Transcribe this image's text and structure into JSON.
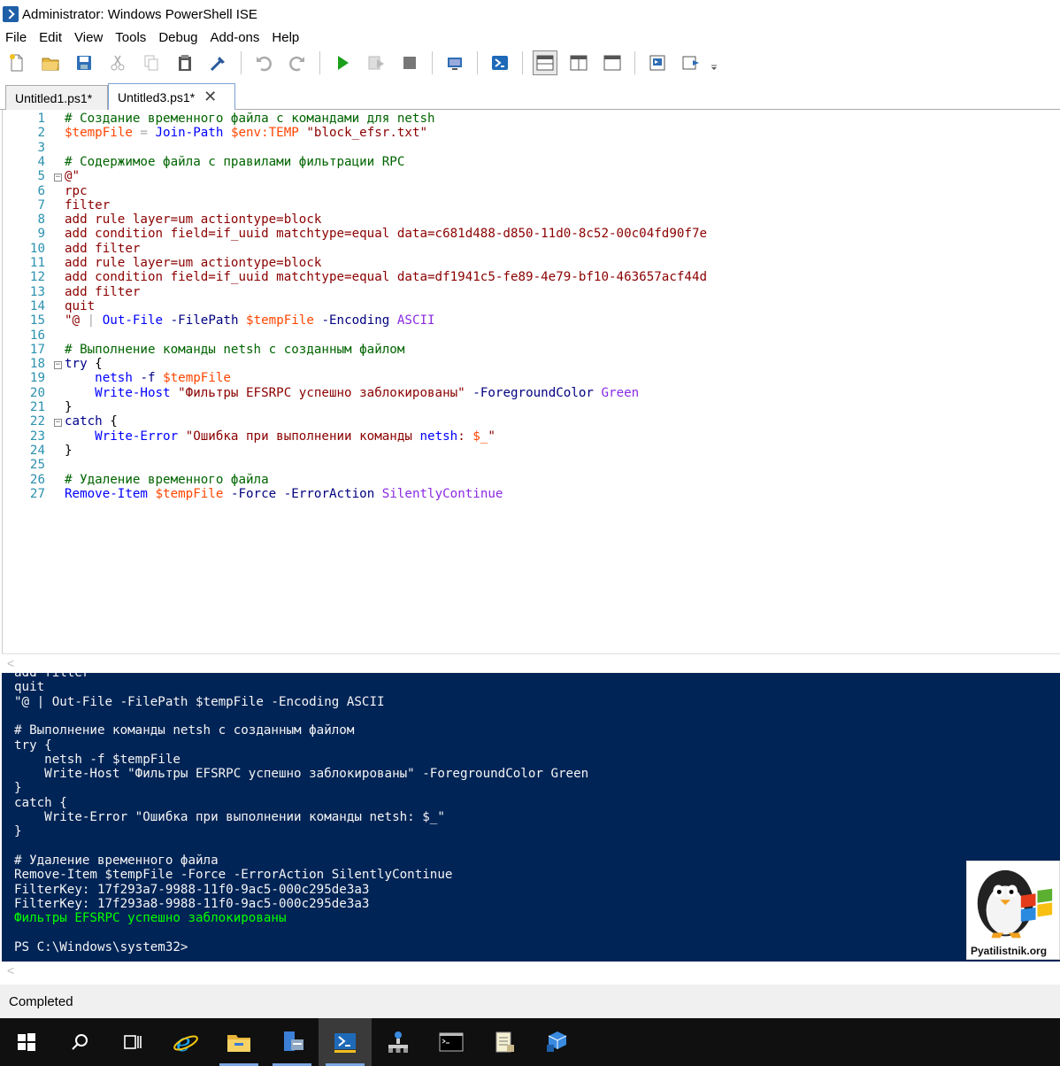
{
  "window": {
    "title": "Administrator: Windows PowerShell ISE"
  },
  "menu": [
    "File",
    "Edit",
    "View",
    "Tools",
    "Debug",
    "Add-ons",
    "Help"
  ],
  "toolbar_icons": [
    "new-file-icon",
    "open-folder-icon",
    "save-icon",
    "cut-icon",
    "copy-icon",
    "paste-icon",
    "clear-console-icon",
    "undo-icon",
    "redo-icon",
    "run-script-icon",
    "run-selection-icon",
    "stop-icon",
    "remote-powershell-icon",
    "powershell-icon",
    "layout-top-icon",
    "layout-right-icon",
    "layout-max-icon",
    "show-command-icon",
    "show-addon-icon",
    "toolbar-overflow-icon"
  ],
  "tabs": [
    {
      "label": "Untitled1.ps1*",
      "active": false
    },
    {
      "label": "Untitled3.ps1*",
      "active": true,
      "close": "✕"
    }
  ],
  "editor": {
    "lines": [
      {
        "n": "1",
        "text": "# Создание временного файла с командами для netsh"
      },
      {
        "n": "2",
        "text": "$tempFile = Join-Path $env:TEMP \"block_efsr.txt\""
      },
      {
        "n": "3",
        "text": ""
      },
      {
        "n": "4",
        "text": "# Содержимое файла с правилами фильтрации RPC"
      },
      {
        "n": "5",
        "text": "@\""
      },
      {
        "n": "6",
        "text": "rpc"
      },
      {
        "n": "7",
        "text": "filter"
      },
      {
        "n": "8",
        "text": "add rule layer=um actiontype=block"
      },
      {
        "n": "9",
        "text": "add condition field=if_uuid matchtype=equal data=c681d488-d850-11d0-8c52-00c04fd90f7e"
      },
      {
        "n": "10",
        "text": "add filter"
      },
      {
        "n": "11",
        "text": "add rule layer=um actiontype=block"
      },
      {
        "n": "12",
        "text": "add condition field=if_uuid matchtype=equal data=df1941c5-fe89-4e79-bf10-463657acf44d"
      },
      {
        "n": "13",
        "text": "add filter"
      },
      {
        "n": "14",
        "text": "quit"
      },
      {
        "n": "15",
        "text": "\"@ | Out-File -FilePath $tempFile -Encoding ASCII"
      },
      {
        "n": "16",
        "text": ""
      },
      {
        "n": "17",
        "text": "# Выполнение команды netsh с созданным файлом"
      },
      {
        "n": "18",
        "text": "try {"
      },
      {
        "n": "19",
        "text": "    netsh -f $tempFile"
      },
      {
        "n": "20",
        "text": "    Write-Host \"Фильтры EFSRPC успешно заблокированы\" -ForegroundColor Green"
      },
      {
        "n": "21",
        "text": "}"
      },
      {
        "n": "22",
        "text": "catch {"
      },
      {
        "n": "23",
        "text": "    Write-Error \"Ошибка при выполнении команды netsh: $_\""
      },
      {
        "n": "24",
        "text": "}"
      },
      {
        "n": "25",
        "text": ""
      },
      {
        "n": "26",
        "text": "# Удаление временного файла"
      },
      {
        "n": "27",
        "text": "Remove-Item $tempFile -Force -ErrorAction SilentlyContinue"
      }
    ]
  },
  "console": {
    "lines": [
      "add filter",
      "quit",
      "\"@ | Out-File -FilePath $tempFile -Encoding ASCII",
      "",
      "# Выполнение команды netsh с созданным файлом",
      "try {",
      "    netsh -f $tempFile",
      "    Write-Host \"Фильтры EFSRPC успешно заблокированы\" -ForegroundColor Green",
      "}",
      "catch {",
      "    Write-Error \"Ошибка при выполнении команды netsh: $_\"",
      "}",
      "",
      "# Удаление временного файла",
      "Remove-Item $tempFile -Force -ErrorAction SilentlyContinue",
      "FilterKey: 17f293a7-9988-11f0-9ac5-000c295de3a3",
      "FilterKey: 17f293a8-9988-11f0-9ac5-000c295de3a3",
      "Фильтры EFSRPC успешно заблокированы",
      "",
      "PS C:\\Windows\\system32>"
    ],
    "green_line_index": 17,
    "background": "#012456",
    "success_color": "#00ff00"
  },
  "status": {
    "text": "Completed"
  },
  "watermark": {
    "text": "Pyatilistnik.org"
  },
  "taskbar": {
    "items": [
      {
        "name": "start-icon"
      },
      {
        "name": "search-icon"
      },
      {
        "name": "task-view-icon"
      },
      {
        "name": "internet-explorer-icon"
      },
      {
        "name": "file-explorer-icon"
      },
      {
        "name": "server-manager-icon"
      },
      {
        "name": "powershell-ise-icon",
        "active": true
      },
      {
        "name": "network-icon"
      },
      {
        "name": "command-prompt-icon"
      },
      {
        "name": "notepad-icon"
      },
      {
        "name": "hyper-v-icon"
      }
    ]
  }
}
